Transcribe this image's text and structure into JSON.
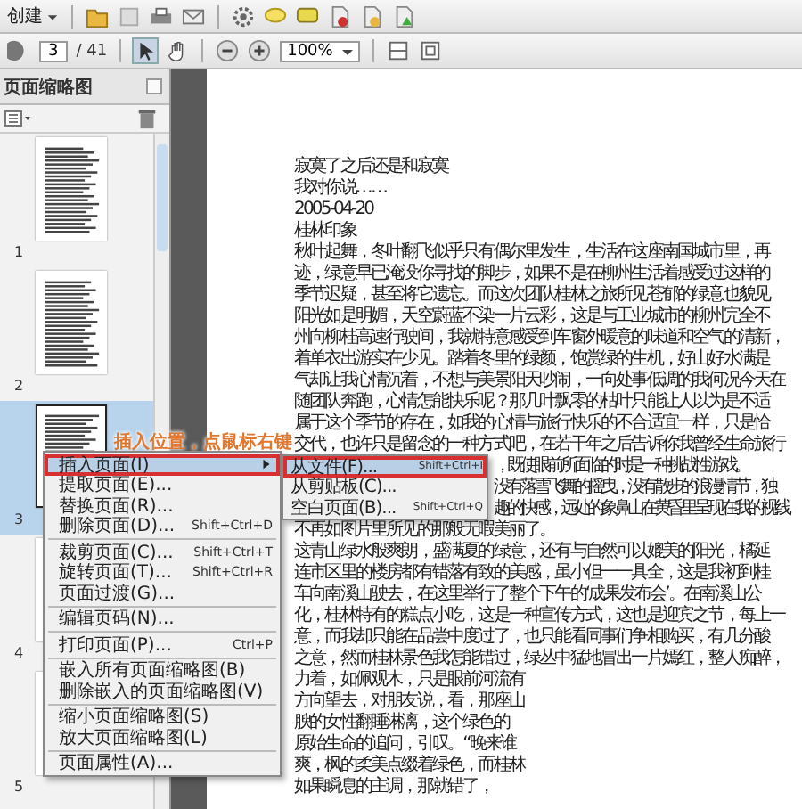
{
  "toolbar": {
    "create_menu": "创建"
  },
  "navigation": {
    "page_number": "3",
    "page_count": "/ 41",
    "zoom": "100%"
  },
  "thumbnails_panel": {
    "title": "页面缩略图",
    "pages": [
      {
        "label": "1",
        "selected": false
      },
      {
        "label": "2",
        "selected": false
      },
      {
        "label": "3",
        "selected": true
      },
      {
        "label": "4",
        "selected": false
      },
      {
        "label": "5",
        "selected": false
      }
    ]
  },
  "document": {
    "lines": [
      {
        "kind": "full",
        "text": "寂寞了之后还是和寂寞"
      },
      {
        "kind": "full",
        "text": "我对你说……"
      },
      {
        "kind": "full",
        "text": "2005-04-20"
      },
      {
        "kind": "full",
        "text": "桂林印象"
      },
      {
        "kind": "full",
        "text": "秋叶起舞，冬叶翻飞似乎只有偶尔里发生，生活在这座南国城市里，再"
      },
      {
        "kind": "full",
        "text": "迹，绿意早已淹没你寻找的脚步，如果不是在柳州生活着感受过这样的"
      },
      {
        "kind": "full",
        "text": "季节迟疑，甚至将它遗忘。而这次团队桂林之旅所见苍郁的绿意也貌见"
      },
      {
        "kind": "full",
        "text": "阳光如是明媚，天空蔚蓝不染一片云彩，这是与工业城市的柳州完全不"
      },
      {
        "kind": "full",
        "text": "州向柳桂高速行驶间，我就特意感受到车窗外暖意的味道和空气的清新，"
      },
      {
        "kind": "full",
        "text": "着单衣出游实在少见。踏着冬里的绿颜，饱赏绿的生机，好山好水满是"
      },
      {
        "kind": "full",
        "text": "气却让我心情沉着，不想与美景阳天吵闹，一向处事低调的我何况今天在"
      },
      {
        "kind": "full",
        "text": "随团队奔跑，心情怎能快乐呢？那几叶飘零的枯叶只能让人以为是不适"
      },
      {
        "kind": "full",
        "text": "属于这个季节的存在，如我的心情与旅行快乐的不合适宜一样，只是恰"
      },
      {
        "kind": "full",
        "text": "交代，也许只是留念的一种方式吧，在若干年之后告诉你我曾经生命旅行"
      },
      {
        "kind": "partial",
        "text": "，既使眼前所面临的时是一种挑战性游戏。"
      },
      {
        "kind": "partial",
        "text": "没有落雪飞舞的摇曳，没有散步的浪漫情节，独"
      },
      {
        "kind": "partial",
        "text": "趣的快感，远处的象鼻山在黄昏里呈现在我的视线"
      },
      {
        "kind": "full",
        "text": "不再如图片里所见的那般无暇美丽了。"
      },
      {
        "kind": "full",
        "text": "这青山绿水般爽朗，盛满夏的绿意，还有与自然可以媲美的阳光，橘延"
      },
      {
        "kind": "full",
        "text": "连市区里的楼房都有错落有致的美感，虽小但一一具全，这是我初到桂"
      },
      {
        "kind": "full",
        "text": "车向南溪山驶去，在这里举行了整个下午的‘成果发布会’。在南溪山公"
      },
      {
        "kind": "full",
        "text": "化，桂林特有的糕点小吃，这是一种宣传方式，这也是迎宾之节，每上一"
      },
      {
        "kind": "full",
        "text": "意，而我却只能在品尝中度过了，也只能看同事们争相购买，有几分酸"
      },
      {
        "kind": "full",
        "text": "之意，然而桂林景色我怎能错过，绿丛中猛地冒出一片嫣红，整人痴醉，"
      },
      {
        "kind": "full",
        "text": "力着，如佩观木，只是眼前河流有"
      },
      {
        "kind": "full",
        "text": "方向望去，对朋友说，看，那座山"
      },
      {
        "kind": "full",
        "text": "腴的女性翻睡淋漓，这个绿色的"
      },
      {
        "kind": "full",
        "text": "原始生命的追问，引叹。“晚来谁"
      },
      {
        "kind": "full",
        "text": "爽，枫的柔美点缀着绿色，而桂林"
      },
      {
        "kind": "full",
        "text": "如果瞬息的主调，那就错了，"
      }
    ]
  },
  "annotation": "插入位置，点鼠标右键",
  "context_menu": {
    "groups": [
      [
        {
          "label": "插入页面(I)",
          "submenu": true,
          "selected": true
        },
        {
          "label": "提取页面(E)...",
          "submenu": false,
          "selected": false
        },
        {
          "label": "替换页面(R)...",
          "submenu": false,
          "selected": false
        },
        {
          "label": "删除页面(D)...",
          "shortcut": "Shift+Ctrl+D",
          "submenu": false,
          "selected": false
        }
      ],
      [
        {
          "label": "裁剪页面(C)...",
          "shortcut": "Shift+Ctrl+T",
          "submenu": false,
          "selected": false
        },
        {
          "label": "旋转页面(T)...",
          "shortcut": "Shift+Ctrl+R",
          "submenu": false,
          "selected": false
        },
        {
          "label": "页面过渡(G)...",
          "submenu": false,
          "selected": false
        }
      ],
      [
        {
          "label": "编辑页码(N)...",
          "submenu": false,
          "selected": false
        }
      ],
      [
        {
          "label": "打印页面(P)...",
          "shortcut": "Ctrl+P",
          "submenu": false,
          "selected": false
        }
      ],
      [
        {
          "label": "嵌入所有页面缩略图(B)",
          "submenu": false,
          "selected": false
        },
        {
          "label": "删除嵌入的页面缩略图(V)",
          "submenu": false,
          "selected": false
        }
      ],
      [
        {
          "label": "缩小页面缩略图(S)",
          "submenu": false,
          "selected": false
        },
        {
          "label": "放大页面缩略图(L)",
          "submenu": false,
          "selected": false
        }
      ],
      [
        {
          "label": "页面属性(A)...",
          "submenu": false,
          "selected": false
        }
      ]
    ]
  },
  "submenu": {
    "items": [
      {
        "label": "从文件(F)...",
        "shortcut": "Shift+Ctrl+I",
        "selected": true
      },
      {
        "label": "从剪贴板(C)...",
        "selected": false
      },
      {
        "label": "空白页面(B)...",
        "shortcut": "Shift+Ctrl+Q",
        "selected": false
      }
    ]
  }
}
